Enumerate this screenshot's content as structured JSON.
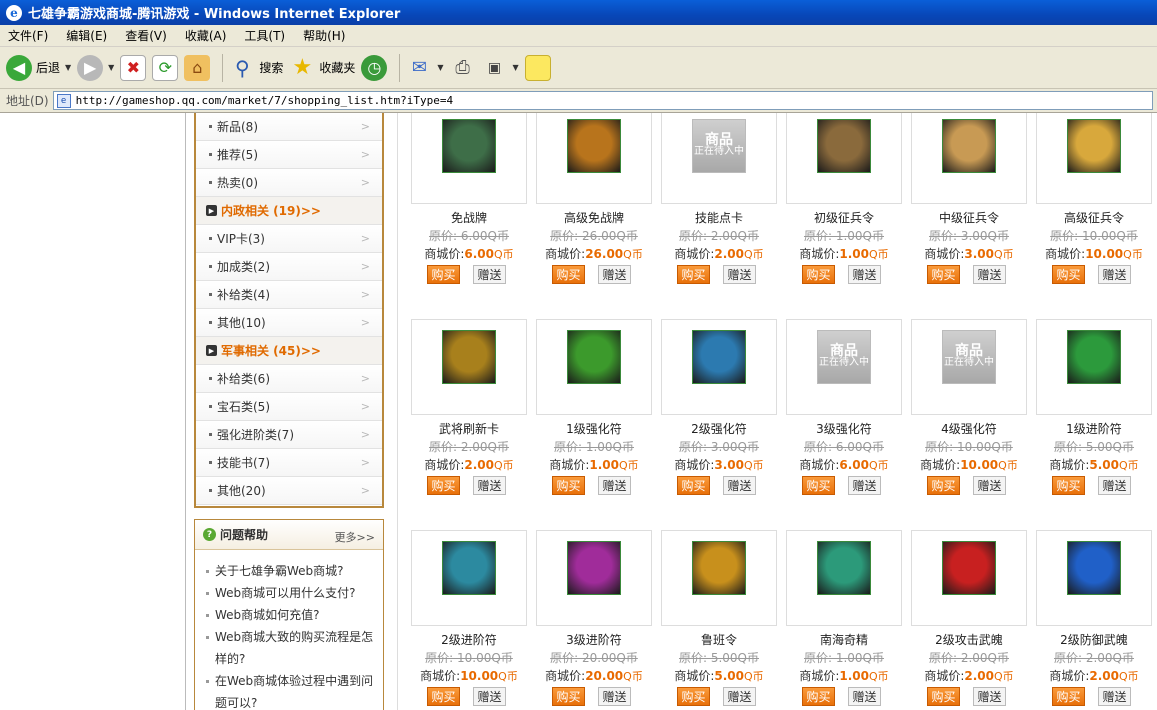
{
  "window": {
    "title": "七雄争霸游戏商城-腾讯游戏 - Windows Internet Explorer"
  },
  "menu": {
    "items": [
      "文件(F)",
      "编辑(E)",
      "查看(V)",
      "收藏(A)",
      "工具(T)",
      "帮助(H)"
    ]
  },
  "toolbar": {
    "back_label": "后退",
    "search_label": "搜索",
    "favorites_label": "收藏夹"
  },
  "address": {
    "label": "地址(D)",
    "url": "http://gameshop.qq.com/market/7/shopping_list.htm?iType=4"
  },
  "categories": {
    "top": [
      {
        "label": "新品(8)"
      },
      {
        "label": "推荐(5)"
      },
      {
        "label": "热卖(0)"
      }
    ],
    "neizheng": {
      "title": "内政相关 (19)>>",
      "items": [
        {
          "label": "VIP卡(3)"
        },
        {
          "label": "加成类(2)"
        },
        {
          "label": "补给类(4)"
        },
        {
          "label": "其他(10)"
        }
      ]
    },
    "junshi": {
      "title": "军事相关 (45)>>",
      "items": [
        {
          "label": "补给类(6)"
        },
        {
          "label": "宝石类(5)"
        },
        {
          "label": "强化进阶类(7)"
        },
        {
          "label": "技能书(7)"
        },
        {
          "label": "其他(20)"
        }
      ]
    }
  },
  "help": {
    "title": "问题帮助",
    "more": "更多>>",
    "items": [
      "关于七雄争霸Web商城?",
      "Web商城可以用什么支付?",
      "Web商城如何充值?",
      "Web商城大致的购买流程是怎样的?",
      "在Web商城体验过程中遇到问题可以?"
    ]
  },
  "shop": {
    "price_label": "商城价:",
    "buy_label": "购买",
    "gift_label": "赠送",
    "placeholder_top": "商品",
    "placeholder_bottom": "正在待入中"
  },
  "products": [
    {
      "name": "免战牌",
      "orig": "原价: 6.00Q币",
      "price": "6.00",
      "unit": "Q币",
      "icon": "green-token-icon",
      "color": "#3e6e48"
    },
    {
      "name": "高级免战牌",
      "orig": "原价: 26.00Q币",
      "price": "26.00",
      "unit": "Q币",
      "icon": "gold-token-icon",
      "color": "#b8741c"
    },
    {
      "name": "技能点卡",
      "orig": "原价: 2.00Q币",
      "price": "2.00",
      "unit": "Q币",
      "icon": "placeholder-icon",
      "color": "#b0b0b0"
    },
    {
      "name": "初级征兵令",
      "orig": "原价: 1.00Q币",
      "price": "1.00",
      "unit": "Q币",
      "icon": "scroll-icon",
      "color": "#8a6a3c"
    },
    {
      "name": "中级征兵令",
      "orig": "原价: 3.00Q币",
      "price": "3.00",
      "unit": "Q币",
      "icon": "scroll-icon",
      "color": "#c89a54"
    },
    {
      "name": "高级征兵令",
      "orig": "原价: 10.00Q币",
      "price": "10.00",
      "unit": "Q币",
      "icon": "scroll-icon",
      "color": "#d8a83c"
    },
    {
      "name": "武将刷新卡",
      "orig": "原价: 2.00Q币",
      "price": "2.00",
      "unit": "Q币",
      "icon": "refresh-card-icon",
      "color": "#a8801c"
    },
    {
      "name": "1级强化符",
      "orig": "原价: 1.00Q币",
      "price": "1.00",
      "unit": "Q币",
      "icon": "talisman-icon",
      "color": "#3c9a2c"
    },
    {
      "name": "2级强化符",
      "orig": "原价: 3.00Q币",
      "price": "3.00",
      "unit": "Q币",
      "icon": "talisman-icon",
      "color": "#2c7ab0"
    },
    {
      "name": "3级强化符",
      "orig": "原价: 6.00Q币",
      "price": "6.00",
      "unit": "Q币",
      "icon": "placeholder-icon",
      "color": "#b0b0b0"
    },
    {
      "name": "4级强化符",
      "orig": "原价: 10.00Q币",
      "price": "10.00",
      "unit": "Q币",
      "icon": "placeholder-icon",
      "color": "#b0b0b0"
    },
    {
      "name": "1级进阶符",
      "orig": "原价: 5.00Q币",
      "price": "5.00",
      "unit": "Q币",
      "icon": "talisman-icon",
      "color": "#2c9a3c"
    },
    {
      "name": "2级进阶符",
      "orig": "原价: 10.00Q币",
      "price": "10.00",
      "unit": "Q币",
      "icon": "talisman-icon",
      "color": "#2c8aa0"
    },
    {
      "name": "3级进阶符",
      "orig": "原价: 20.00Q币",
      "price": "20.00",
      "unit": "Q币",
      "icon": "talisman-icon",
      "color": "#a02c9a"
    },
    {
      "name": "鲁班令",
      "orig": "原价: 5.00Q币",
      "price": "5.00",
      "unit": "Q币",
      "icon": "gold-blade-icon",
      "color": "#c8901c"
    },
    {
      "name": "南海奇精",
      "orig": "原价: 1.00Q币",
      "price": "1.00",
      "unit": "Q币",
      "icon": "pearl-icon",
      "color": "#2c9a7a"
    },
    {
      "name": "2级攻击武魄",
      "orig": "原价: 2.00Q币",
      "price": "2.00",
      "unit": "Q币",
      "icon": "red-gem-icon",
      "color": "#c82020"
    },
    {
      "name": "2级防御武魄",
      "orig": "原价: 2.00Q币",
      "price": "2.00",
      "unit": "Q币",
      "icon": "blue-gem-icon",
      "color": "#2060c8"
    }
  ]
}
